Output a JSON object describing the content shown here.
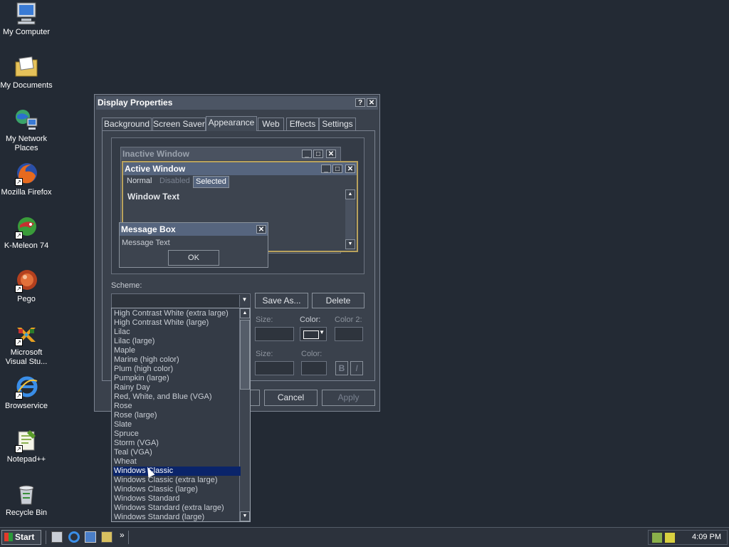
{
  "desktop": {
    "icons": [
      {
        "label": "My Computer",
        "icon": "computer-icon"
      },
      {
        "label": "My Documents",
        "icon": "folder-documents-icon"
      },
      {
        "label": "My Network Places",
        "icon": "network-icon"
      },
      {
        "label": "Mozilla Firefox",
        "icon": "firefox-icon"
      },
      {
        "label": "K-Meleon 74",
        "icon": "kmeleon-icon"
      },
      {
        "label": "Pego",
        "icon": "pego-icon"
      },
      {
        "label": "Microsoft Visual Stu...",
        "icon": "visual-studio-icon"
      },
      {
        "label": "Browservice",
        "icon": "browser-icon"
      },
      {
        "label": "Notepad++",
        "icon": "notepad-icon"
      },
      {
        "label": "Recycle Bin",
        "icon": "recycle-bin-icon"
      }
    ]
  },
  "dialog": {
    "title": "Display Properties",
    "help_glyph": "?",
    "close_glyph": "✕",
    "tabs": [
      "Background",
      "Screen Saver",
      "Appearance",
      "Web",
      "Effects",
      "Settings"
    ],
    "active_tab": "Appearance",
    "preview": {
      "inactive_title": "Inactive Window",
      "active_title": "Active Window",
      "menu_normal": "Normal",
      "menu_disabled": "Disabled",
      "menu_selected": "Selected",
      "window_text": "Window Text",
      "msgbox_title": "Message Box",
      "msgbox_text": "Message Text",
      "ok": "OK"
    },
    "scheme_label": "Scheme:",
    "save_as": "Save As...",
    "delete": "Delete",
    "size_label": "Size:",
    "color_label": "Color:",
    "color2_label": "Color 2:",
    "bold_label": "B",
    "italic_label": "I",
    "cancel": "Cancel",
    "apply": "Apply"
  },
  "scheme_list": {
    "items": [
      "High Contrast White (extra large)",
      "High Contrast White (large)",
      "Lilac",
      "Lilac (large)",
      "Maple",
      "Marine (high color)",
      "Plum (high color)",
      "Pumpkin (large)",
      "Rainy Day",
      "Red, White, and Blue (VGA)",
      "Rose",
      "Rose (large)",
      "Slate",
      "Spruce",
      "Storm (VGA)",
      "Teal (VGA)",
      "Wheat",
      "Windows Classic",
      "Windows Classic (extra large)",
      "Windows Classic (large)",
      "Windows Standard",
      "Windows Standard (extra large)",
      "Windows Standard (large)"
    ],
    "selected": "Windows Classic"
  },
  "taskbar": {
    "start_label": "Start",
    "quicklaunch": [
      "show-desktop-icon",
      "ie-icon",
      "outlook-icon",
      "media-icon"
    ],
    "chevron": "»",
    "clock": "4:09 PM"
  },
  "colors": {
    "desktop_bg": "#232a34",
    "selection": "#0a246a",
    "active_border": "#b8a15c"
  }
}
